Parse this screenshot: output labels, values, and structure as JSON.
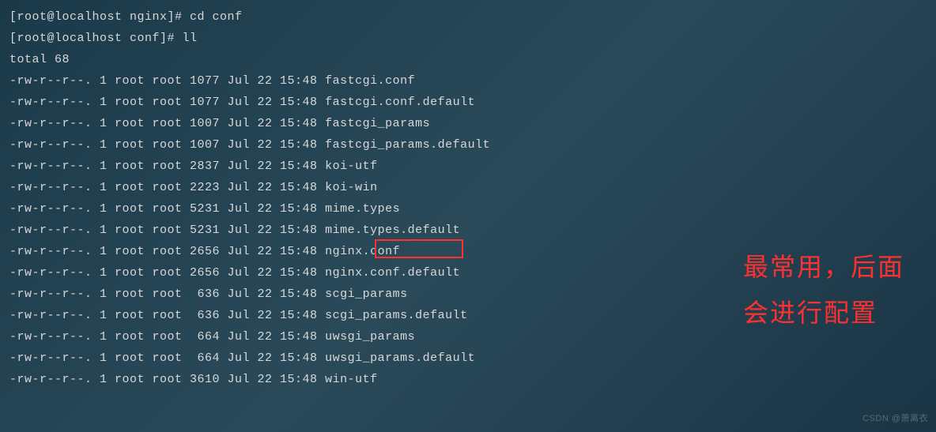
{
  "prompt1": {
    "prefix": "[root@localhost nginx]# ",
    "command": "cd conf"
  },
  "prompt2": {
    "prefix": "[root@localhost conf]# ",
    "command": "ll"
  },
  "total": "total 68",
  "files": [
    {
      "perms": "-rw-r--r--. 1 root root 1077 Jul 22 15:48 ",
      "name": "fastcgi.conf",
      "highlighted": false
    },
    {
      "perms": "-rw-r--r--. 1 root root 1077 Jul 22 15:48 ",
      "name": "fastcgi.conf.default",
      "highlighted": false
    },
    {
      "perms": "-rw-r--r--. 1 root root 1007 Jul 22 15:48 ",
      "name": "fastcgi_params",
      "highlighted": false
    },
    {
      "perms": "-rw-r--r--. 1 root root 1007 Jul 22 15:48 ",
      "name": "fastcgi_params.default",
      "highlighted": false
    },
    {
      "perms": "-rw-r--r--. 1 root root 2837 Jul 22 15:48 ",
      "name": "koi-utf",
      "highlighted": false
    },
    {
      "perms": "-rw-r--r--. 1 root root 2223 Jul 22 15:48 ",
      "name": "koi-win",
      "highlighted": false
    },
    {
      "perms": "-rw-r--r--. 1 root root 5231 Jul 22 15:48 ",
      "name": "mime.types",
      "highlighted": false
    },
    {
      "perms": "-rw-r--r--. 1 root root 5231 Jul 22 15:48 ",
      "name": "mime.types.default",
      "highlighted": false
    },
    {
      "perms": "-rw-r--r--. 1 root root 2656 Jul 22 15:48 ",
      "name": "nginx.conf",
      "highlighted": true
    },
    {
      "perms": "-rw-r--r--. 1 root root 2656 Jul 22 15:48 ",
      "name": "nginx.conf.default",
      "highlighted": false
    },
    {
      "perms": "-rw-r--r--. 1 root root  636 Jul 22 15:48 ",
      "name": "scgi_params",
      "highlighted": false
    },
    {
      "perms": "-rw-r--r--. 1 root root  636 Jul 22 15:48 ",
      "name": "scgi_params.default",
      "highlighted": false
    },
    {
      "perms": "-rw-r--r--. 1 root root  664 Jul 22 15:48 ",
      "name": "uwsgi_params",
      "highlighted": false
    },
    {
      "perms": "-rw-r--r--. 1 root root  664 Jul 22 15:48 ",
      "name": "uwsgi_params.default",
      "highlighted": false
    },
    {
      "perms": "-rw-r--r--. 1 root root 3610 Jul 22 15:48 ",
      "name": "win-utf",
      "highlighted": false
    }
  ],
  "annotation_line1": "最常用，后面",
  "annotation_line2": "会进行配置",
  "watermark": "CSDN @萧离衣"
}
